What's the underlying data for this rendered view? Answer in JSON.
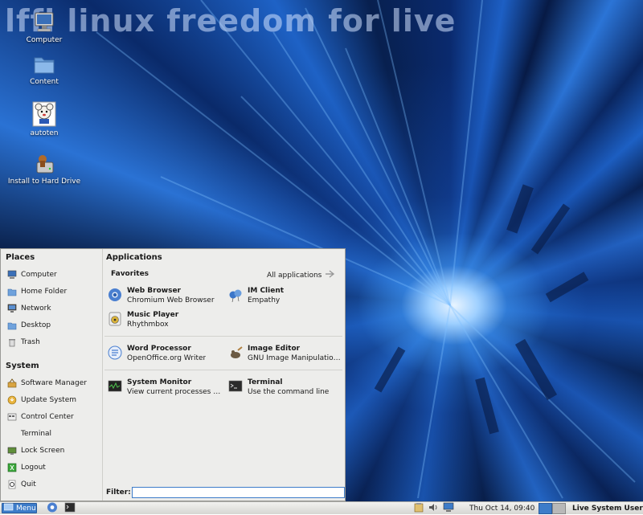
{
  "wallpaper": {
    "title": "lffl linux freedom for live"
  },
  "desktop": {
    "icons": [
      {
        "label": "Computer",
        "icon": "computer-icon"
      },
      {
        "label": "Content",
        "icon": "folder-icon"
      },
      {
        "label": "autoten",
        "icon": "autoten-icon"
      },
      {
        "label": "Install to Hard Drive",
        "icon": "installer-icon"
      }
    ]
  },
  "menu": {
    "places_heading": "Places",
    "places": [
      "Computer",
      "Home Folder",
      "Network",
      "Desktop",
      "Trash"
    ],
    "system_heading": "System",
    "system": [
      "Software Manager",
      "Update System",
      "Control Center",
      "Terminal",
      "Lock Screen",
      "Logout",
      "Quit"
    ],
    "applications_heading": "Applications",
    "favorites_label": "Favorites",
    "all_applications": "All applications",
    "apps": [
      {
        "name": "Web Browser",
        "desc": "Chromium Web Browser",
        "icon": "chromium-icon"
      },
      {
        "name": "IM Client",
        "desc": "Empathy",
        "icon": "empathy-icon"
      },
      {
        "name": "Music Player",
        "desc": "Rhythmbox",
        "icon": "rhythmbox-icon"
      },
      {
        "name": "Word Processor",
        "desc": "OpenOffice.org Writer",
        "icon": "writer-icon"
      },
      {
        "name": "Image Editor",
        "desc": "GNU Image Manipulation ...",
        "icon": "gimp-icon"
      },
      {
        "name": "System Monitor",
        "desc": "View current processes a...",
        "icon": "system-monitor-icon"
      },
      {
        "name": "Terminal",
        "desc": "Use the command line",
        "icon": "terminal-icon"
      }
    ],
    "filter_label": "Filter:",
    "filter_value": ""
  },
  "taskbar": {
    "menu_label": "Menu",
    "clock": "Thu Oct 14, 09:40",
    "user": "Live System User"
  },
  "colors": {
    "accent": "#3d7cc9",
    "menu_bg": "#ededeb"
  }
}
